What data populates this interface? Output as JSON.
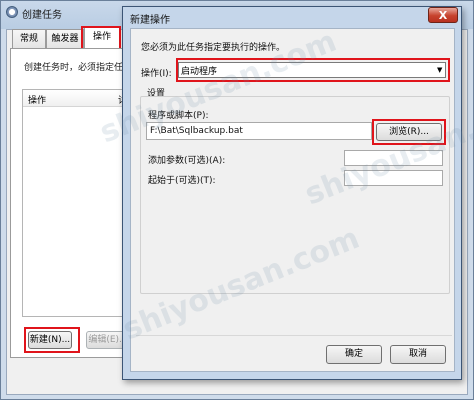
{
  "main_window": {
    "title": "创建任务",
    "tabs": [
      {
        "label": "常规",
        "active": false
      },
      {
        "label": "触发器",
        "active": false
      },
      {
        "label": "操作",
        "active": true
      }
    ],
    "description": "创建任务时，必须指定任",
    "list": {
      "columns": [
        "操作",
        "详"
      ]
    },
    "buttons": {
      "new": "新建(N)...",
      "edit": "编辑(E)..."
    }
  },
  "dialog": {
    "title": "新建操作",
    "close_label": "X",
    "instruction": "您必须为此任务指定要执行的操作。",
    "action_label": "操作(I):",
    "action_value": "启动程序",
    "settings_label": "设置",
    "program_label": "程序或脚本(P):",
    "program_value": "F:\\Bat\\Sqlbackup.bat",
    "browse_button": "浏览(R)...",
    "args_label": "添加参数(可选)(A):",
    "args_value": "",
    "start_in_label": "起始于(可选)(T):",
    "start_in_value": "",
    "ok_button": "确定",
    "cancel_button": "取消"
  },
  "watermark": "shiyousan.com",
  "colors": {
    "highlight_red": "#e0141b",
    "title_bar": "#c5d6ea",
    "close_red": "#c7422d"
  }
}
